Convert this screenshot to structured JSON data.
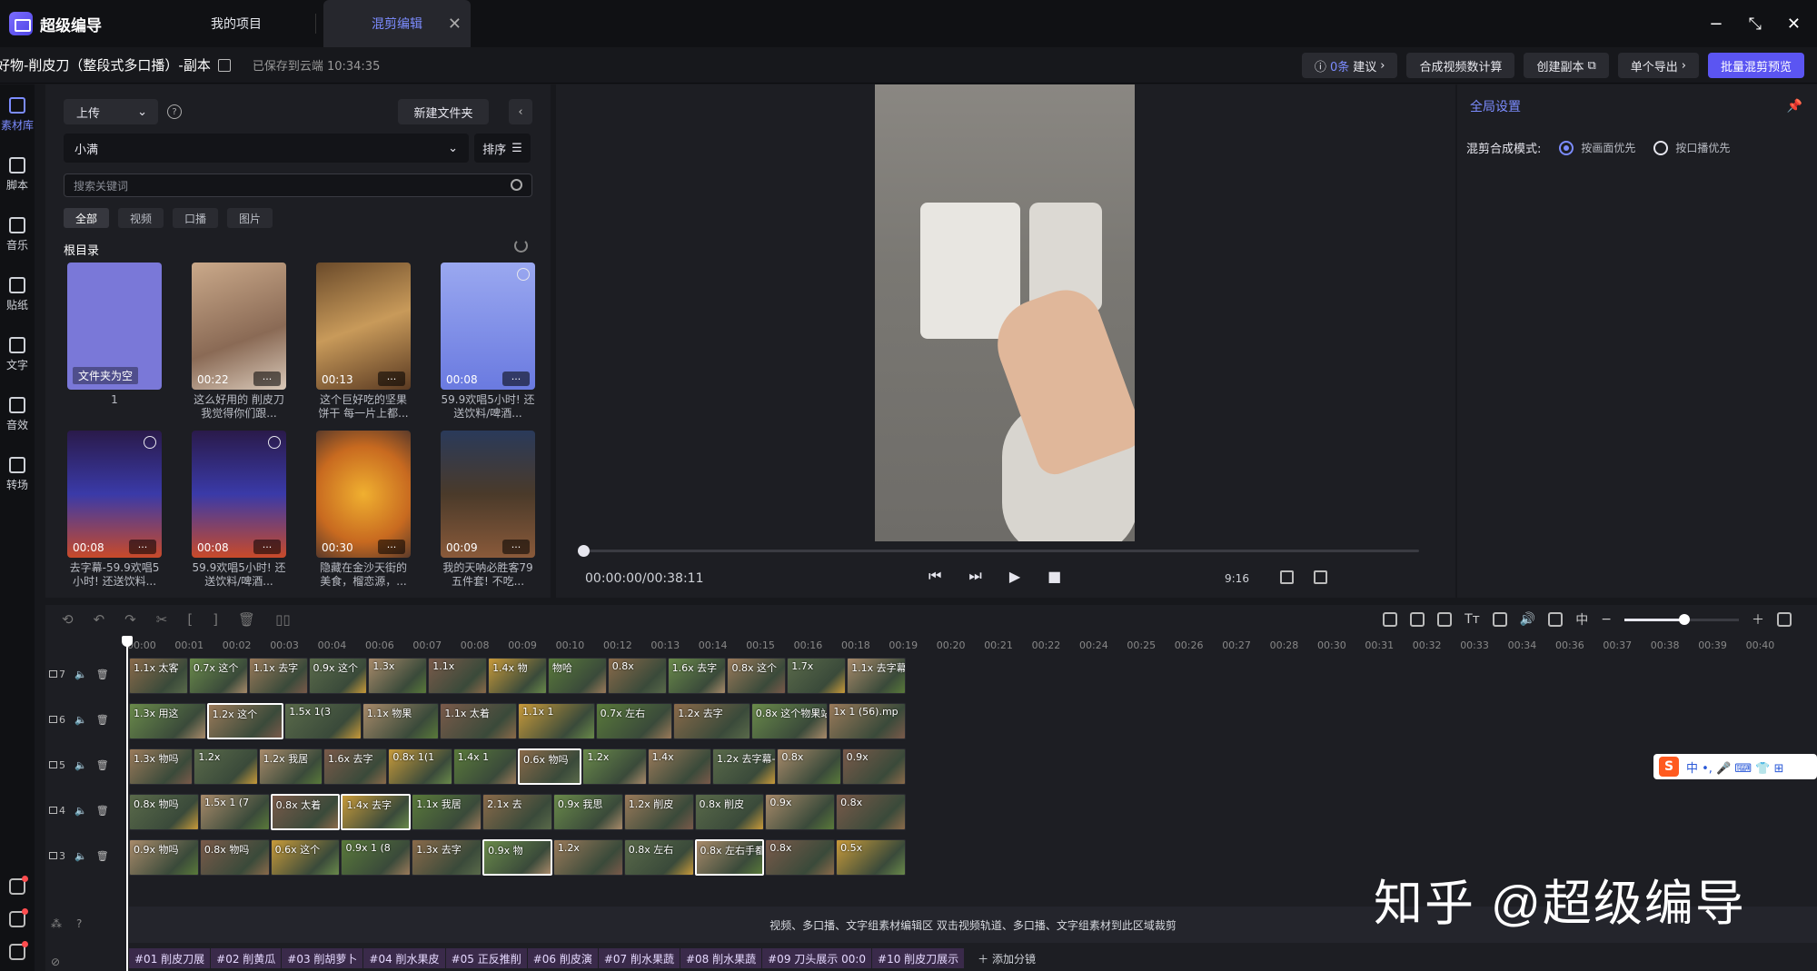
{
  "app": {
    "name": "超级编导"
  },
  "tabs": {
    "projects": "我的项目",
    "active": "混剪编辑",
    "close": "✕"
  },
  "window": {
    "minimize": "−",
    "restore": "⤡",
    "close": "✕"
  },
  "doc": {
    "name": "好物-削皮刀（整段式多口播）-副本",
    "saved": "已保存到云端 10:34:35"
  },
  "actions": {
    "suggest_count": "0条",
    "suggest": "建议",
    "calc": "合成视频数计算",
    "copy": "创建副本",
    "export": "单个导出",
    "batch": "批量混剪预览"
  },
  "rail": [
    {
      "label": "素材库",
      "icon": "media-library-icon"
    },
    {
      "label": "脚本",
      "icon": "script-icon"
    },
    {
      "label": "音乐",
      "icon": "music-icon"
    },
    {
      "label": "贴纸",
      "icon": "sticker-icon"
    },
    {
      "label": "文字",
      "icon": "text-icon"
    },
    {
      "label": "音效",
      "icon": "sound-effect-icon"
    },
    {
      "label": "转场",
      "icon": "transition-icon"
    }
  ],
  "library": {
    "upload": "上传",
    "new_folder": "新建文件夹",
    "folder": "小满",
    "sort": "排序",
    "search_placeholder": "搜索关键词",
    "filters": [
      "全部",
      "视频",
      "口播",
      "图片"
    ],
    "root": "根目录",
    "items": [
      {
        "duration": "",
        "caption": "1",
        "empty_label": "文件夹为空"
      },
      {
        "duration": "00:22",
        "caption": "这么好用的 削皮刀 我觉得你们跟..."
      },
      {
        "duration": "00:13",
        "caption": "这个巨好吃的坚果饼干 每一片上都..."
      },
      {
        "duration": "00:08",
        "caption": "59.9欢唱5小时! 还送饮料/啤酒..."
      },
      {
        "duration": "00:08",
        "caption": "去字幕-59.9欢唱5小时! 还送饮料..."
      },
      {
        "duration": "00:08",
        "caption": "59.9欢唱5小时! 还送饮料/啤酒..."
      },
      {
        "duration": "00:30",
        "caption": "隐藏在金沙天街的美食，榴恋源，..."
      },
      {
        "duration": "00:09",
        "caption": "我的天呐必胜客79五件套! 不吃..."
      }
    ],
    "more": "···"
  },
  "preview": {
    "timecode": "00:00:00/00:38:11",
    "ratio": "9:16",
    "progress": 0
  },
  "settings": {
    "title": "全局设置",
    "mode_label": "混剪合成模式:",
    "options": [
      "按画面优先",
      "按口播优先"
    ],
    "selected": 0
  },
  "timeline": {
    "ruler": [
      "00:00",
      "00:01",
      "00:02",
      "00:03",
      "00:04",
      "00:06",
      "00:07",
      "00:08",
      "00:09",
      "00:10",
      "00:12",
      "00:13",
      "00:14",
      "00:15",
      "00:16",
      "00:18",
      "00:19",
      "00:20",
      "00:21",
      "00:22",
      "00:24",
      "00:25",
      "00:26",
      "00:27",
      "00:28",
      "00:30",
      "00:31",
      "00:32",
      "00:33",
      "00:34",
      "00:36",
      "00:37",
      "00:38",
      "00:39",
      "00:40"
    ],
    "tracks": [
      {
        "id": "7",
        "clips": [
          "1.1x 太客",
          "0.7x 这个",
          "1.1x 去字",
          "0.9x 这个",
          "1.3x",
          "1.1x",
          "1.4x 物",
          "物哈",
          "0.8x",
          "1.6x 去字",
          "0.8x 这个",
          "1.7x",
          "1.1x 去字幕"
        ]
      },
      {
        "id": "6",
        "clips": [
          "1.3x 用这",
          "1.2x 这个",
          "1.5x 1(3",
          "1.1x 物果",
          "1.1x 太着",
          "1.1x 1",
          "0.7x 左右",
          "1.2x 去字",
          "0.8x 这个物果站",
          "1x 1 (56).mp"
        ]
      },
      {
        "id": "5",
        "clips": [
          "1.3x 物吗",
          "1.2x",
          "1.2x 我居",
          "1.6x 去字",
          "0.8x 1(1",
          "1.4x 1",
          "0.6x 物吗",
          "1.2x",
          "1.4x",
          "1.2x 去字幕-用",
          "0.8x",
          "0.9x"
        ]
      },
      {
        "id": "4",
        "clips": [
          "0.8x 物吗",
          "1.5x 1 (7",
          "0.8x 太着",
          "1.4x 去字",
          "1.1x 我居",
          "2.1x 去",
          "0.9x 我思",
          "1.2x 削皮",
          "0.8x 削皮",
          "0.9x",
          "0.8x"
        ]
      },
      {
        "id": "3",
        "clips": [
          "0.9x 物吗",
          "0.8x 物吗",
          "0.6x 这个",
          "0.9x 1 (8",
          "1.3x 去字",
          "0.9x 物",
          "1.2x",
          "0.8x 左右",
          "0.8x 左右手都能",
          "0.8x",
          "0.5x"
        ]
      }
    ],
    "hint": "视频、多口播、文字组素材编辑区   双击视频轨道、多口播、文字组素材到此区域裁剪",
    "groups": [
      "#01 削皮刀展",
      "#02 削黄瓜",
      "#03 削胡萝卜",
      "#04 削水果皮",
      "#05 正反推削",
      "#06 削皮演",
      "#07 削水果蔬",
      "#08 削水果蔬",
      "#09 刀头展示 00:0",
      "#10 削皮刀展示"
    ],
    "add_group": "＋ 添加分镜"
  },
  "watermark": "知乎 @超级编导",
  "ime": {
    "logo": "S",
    "text": "中 •, 🎤 ⌨ 👕 ⊞"
  }
}
